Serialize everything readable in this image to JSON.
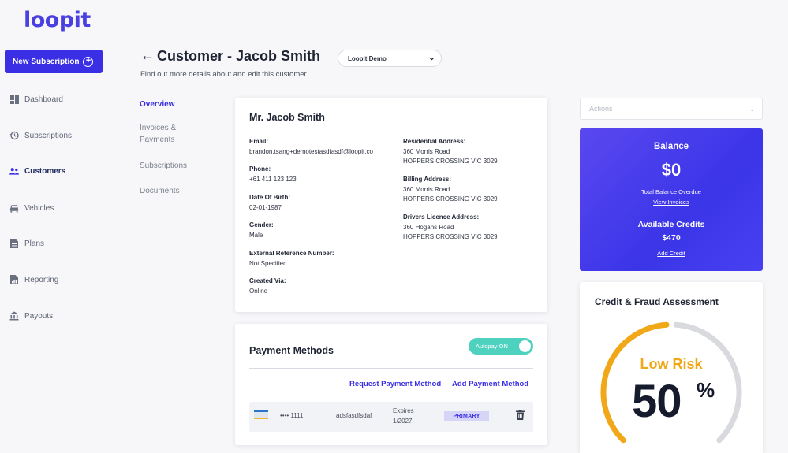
{
  "brand": {
    "logo": "loopit",
    "accent": "#3b2fe6"
  },
  "sidebar": {
    "new_button": "New Subscription",
    "items": [
      {
        "label": "Dashboard",
        "icon": "dashboard-icon"
      },
      {
        "label": "Subscriptions",
        "icon": "history-icon"
      },
      {
        "label": "Customers",
        "icon": "users-icon",
        "active": true
      },
      {
        "label": "Vehicles",
        "icon": "car-icon"
      },
      {
        "label": "Plans",
        "icon": "document-icon"
      },
      {
        "label": "Reporting",
        "icon": "report-icon"
      },
      {
        "label": "Payouts",
        "icon": "bank-icon"
      }
    ]
  },
  "header": {
    "title": "Customer - Jacob Smith",
    "org_selector": "Loopit Demo",
    "subtitle": "Find out more details about and edit this customer."
  },
  "subnav": {
    "items": [
      {
        "label": "Overview",
        "active": true
      },
      {
        "label": "Invoices & Payments"
      },
      {
        "label": "Subscriptions"
      },
      {
        "label": "Documents"
      }
    ]
  },
  "profile": {
    "name": "Mr. Jacob Smith",
    "left_fields": [
      {
        "label": "Email:",
        "value": "brandon.tsang+demotestasdfasdf@loopit.co"
      },
      {
        "label": "Phone:",
        "value": "+61 411 123 123"
      },
      {
        "label": "Date Of Birth:",
        "value": "02-01-1987"
      },
      {
        "label": "Gender:",
        "value": "Male"
      },
      {
        "label": "External Reference Number:",
        "value": "Not Specified"
      },
      {
        "label": "Created Via:",
        "value": "Online"
      }
    ],
    "right_fields": [
      {
        "label": "Residential Address:",
        "line1": "360 Morris Road",
        "line2": "HOPPERS CROSSING VIC 3029"
      },
      {
        "label": "Billing Address:",
        "line1": "360 Morris Road",
        "line2": "HOPPERS CROSSING VIC 3029"
      },
      {
        "label": "Drivers Licence Address:",
        "line1": "360 Hogans Road",
        "line2": "HOPPERS CROSSING VIC 3029"
      }
    ]
  },
  "payment_methods": {
    "title": "Payment Methods",
    "autopay_label": "Autopay ON",
    "request_link": "Request Payment Method",
    "add_link": "Add Payment Method",
    "card": {
      "number": "•••• 1111",
      "nickname": "adsfasdfsdaf",
      "expires_label": "Expires",
      "expires_value": "1/2027",
      "badge": "PRIMARY"
    }
  },
  "actions": {
    "placeholder": "Actions"
  },
  "balance": {
    "title": "Balance",
    "amount": "$0",
    "overdue_label": "Total Balance Overdue",
    "view_invoices": "View Invoices",
    "credits_title": "Available Credits",
    "credits_amount": "$470",
    "add_credit": "Add Credit"
  },
  "risk": {
    "title": "Credit & Fraud Assessment",
    "level": "Low Risk",
    "percent_value": "50",
    "percent_sign": "%",
    "score_fraction": 0.5,
    "color_ok": "#f0a818",
    "color_track": "#d9dade"
  }
}
